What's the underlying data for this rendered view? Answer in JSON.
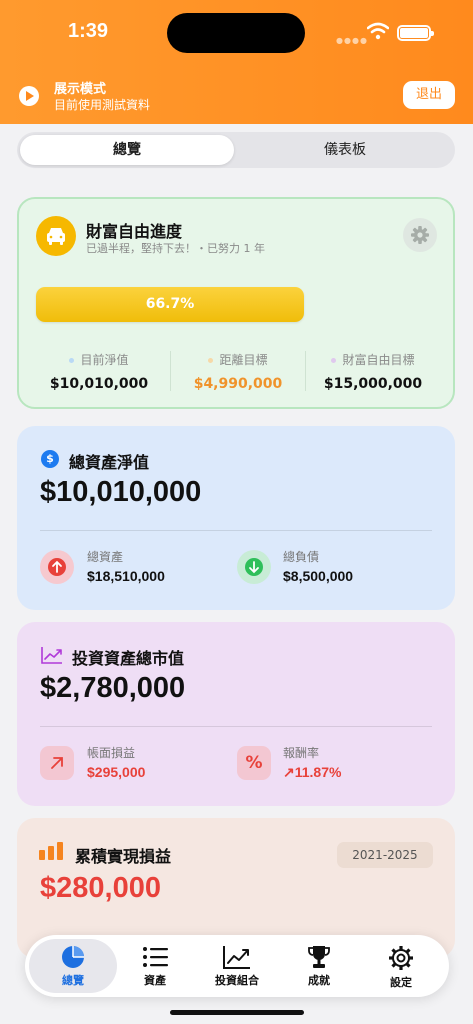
{
  "status": {
    "time": "1:39"
  },
  "demo": {
    "title": "展示模式",
    "subtitle": "目前使用測試資料",
    "exit_label": "退出"
  },
  "segments": {
    "overview": "總覽",
    "dashboard": "儀表板"
  },
  "fire": {
    "title": "財富自由進度",
    "subtitle": "已過半程，堅持下去！・已努力 1 年",
    "progress_label": "66.7%",
    "progress": 0.667,
    "stats": [
      {
        "label": "目前淨值",
        "value": "$10,010,000",
        "dot_color": "#b9d9f5",
        "value_color": "#111111"
      },
      {
        "label": "距離目標",
        "value": "$4,990,000",
        "dot_color": "#f6d9a8",
        "value_color": "#f0932b"
      },
      {
        "label": "財富自由目標",
        "value": "$15,000,000",
        "dot_color": "#e0c9ee",
        "value_color": "#111111"
      }
    ]
  },
  "net_worth": {
    "title": "總資產淨值",
    "value": "$10,010,000",
    "assets_label": "總資產",
    "assets_value": "$18,510,000",
    "liabilities_label": "總負債",
    "liabilities_value": "$8,500,000"
  },
  "investment": {
    "title": "投資資產總市值",
    "value": "$2,780,000",
    "pl_label": "帳面損益",
    "pl_value": "$295,000",
    "return_label": "報酬率",
    "return_value": "↗11.87%",
    "percent_symbol": "%"
  },
  "realized": {
    "title": "累積實現損益",
    "range": "2021-2025",
    "value": "$280,000"
  },
  "tabs": [
    {
      "label": "總覽",
      "icon": "pie-chart-icon"
    },
    {
      "label": "資產",
      "icon": "list-icon"
    },
    {
      "label": "投資組合",
      "icon": "trend-chart-icon"
    },
    {
      "label": "成就",
      "icon": "trophy-icon"
    },
    {
      "label": "設定",
      "icon": "gear-icon"
    }
  ],
  "colors": {
    "brand_orange": "#ff8a1d",
    "positive_red": "#e8413a",
    "active_blue": "#1d6fe0"
  }
}
